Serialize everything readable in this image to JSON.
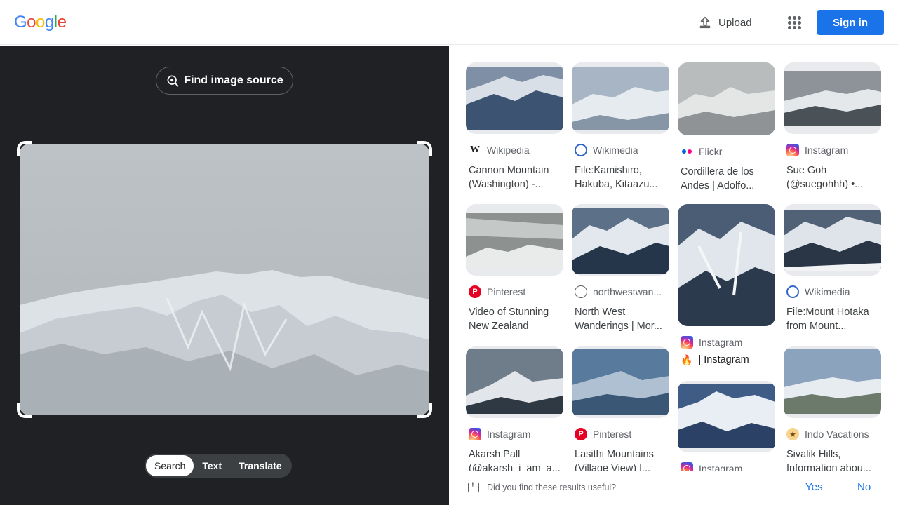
{
  "header": {
    "logo_letters": [
      {
        "char": "G",
        "color": "#4285f4"
      },
      {
        "char": "o",
        "color": "#ea4335"
      },
      {
        "char": "o",
        "color": "#fbbc05"
      },
      {
        "char": "g",
        "color": "#4285f4"
      },
      {
        "char": "l",
        "color": "#34a853"
      },
      {
        "char": "e",
        "color": "#ea4335"
      }
    ],
    "upload_label": "Upload",
    "upload_icon": "upload-icon",
    "apps_icon": "apps-grid-icon",
    "signin_label": "Sign in"
  },
  "lens": {
    "find_source_label": "Find image source",
    "find_source_icon": "lens-search-icon",
    "tabs": [
      {
        "label": "Search",
        "active": true
      },
      {
        "label": "Text",
        "active": false
      },
      {
        "label": "Translate",
        "active": false
      }
    ]
  },
  "results": [
    {
      "source": "Wikipedia",
      "icon": "wikipedia-icon",
      "title": "Cannon Mountain (Washington) -..."
    },
    {
      "source": "Wikimedia",
      "icon": "wikimedia-icon",
      "title": "File:Kamishiro, Hakuba, Kitaazu..."
    },
    {
      "source": "Flickr",
      "icon": "flickr-icon",
      "title": "Cordillera de los Andes | Adolfo..."
    },
    {
      "source": "Instagram",
      "icon": "instagram-icon",
      "title": "Sue Goh (@suegohhh) •..."
    },
    {
      "source": "Pinterest",
      "icon": "pinterest-icon",
      "title": "Video of Stunning New Zealand"
    },
    {
      "source": "northwestwan...",
      "icon": "globe-icon",
      "title": "North West Wanderings | Mor..."
    },
    {
      "source": "Instagram",
      "icon": "instagram-icon",
      "title": "| Instagram"
    },
    {
      "source": "Wikimedia",
      "icon": "wikimedia-icon",
      "title": "File:Mount Hotaka from Mount..."
    },
    {
      "source": "Instagram",
      "icon": "instagram-icon",
      "title": "Akarsh Pall (@akarsh_i_am_a..."
    },
    {
      "source": "Pinterest",
      "icon": "pinterest-icon",
      "title": "Lasithi Mountains (Village View) |..."
    },
    {
      "source": "Instagram",
      "icon": "instagram-icon",
      "title": ""
    },
    {
      "source": "Indo Vacations",
      "icon": "indo-vacations-icon",
      "title": "Sivalik Hills, Information abou..."
    }
  ],
  "feedback": {
    "question": "Did you find these results useful?",
    "yes_label": "Yes",
    "no_label": "No",
    "icon": "feedback-icon"
  },
  "colors": {
    "accent": "#1a73e8",
    "panel_dark": "#202124"
  }
}
